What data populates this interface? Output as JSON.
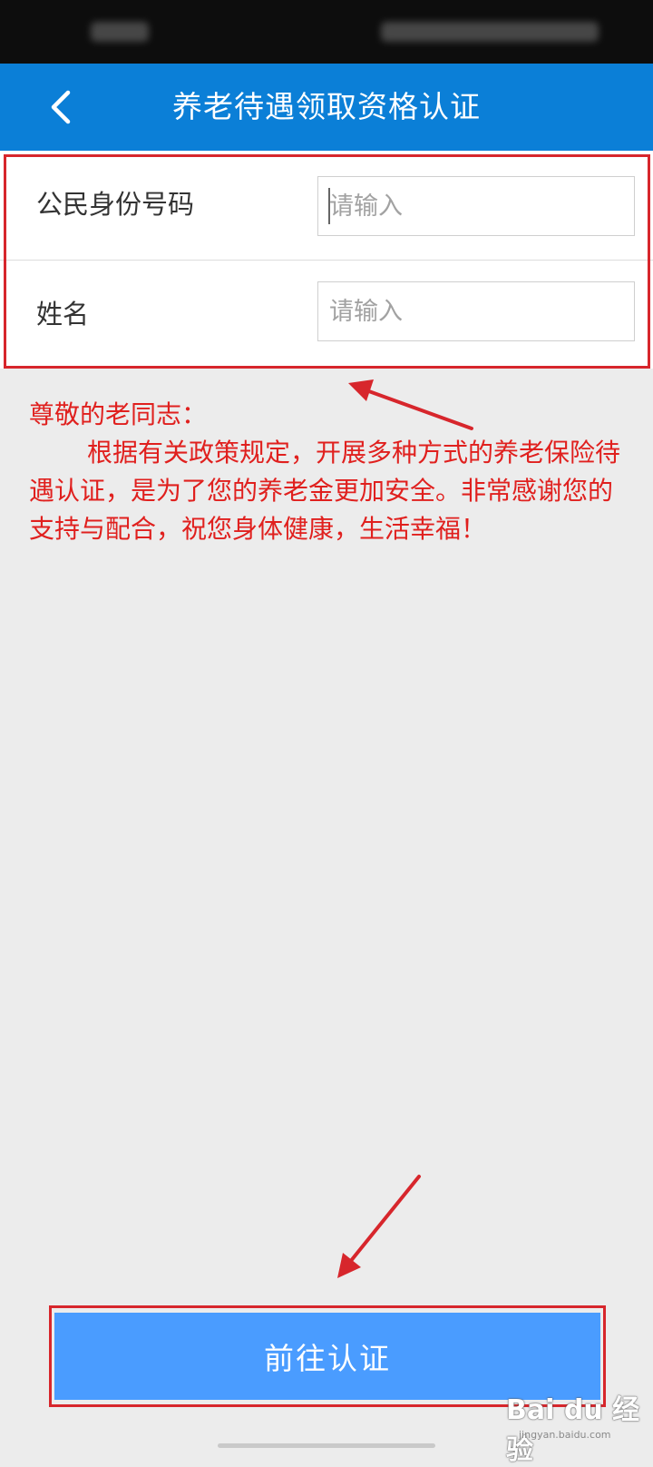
{
  "app_bar": {
    "title": "养老待遇领取资格认证",
    "back_icon": "chevron-left-icon",
    "background": "#0b7fd7"
  },
  "form": {
    "id_number": {
      "label": "公民身份号码",
      "placeholder": "请输入",
      "value": ""
    },
    "name": {
      "label": "姓名",
      "placeholder": "请输入",
      "value": ""
    }
  },
  "notice": {
    "greeting": "尊敬的老同志：",
    "body": "根据有关政策规定，开展多种方式的养老保险待遇认证，是为了您的养老金更加安全。非常感谢您的支持与配合，祝您身体健康，生活幸福！",
    "color": "#e0201e"
  },
  "primary_button": {
    "label": "前往认证",
    "background": "#4a9cff"
  },
  "watermark": {
    "text": "Bai du 经验",
    "subtext": "jingyan.baidu.com"
  },
  "annotation_color": "#d7262c"
}
